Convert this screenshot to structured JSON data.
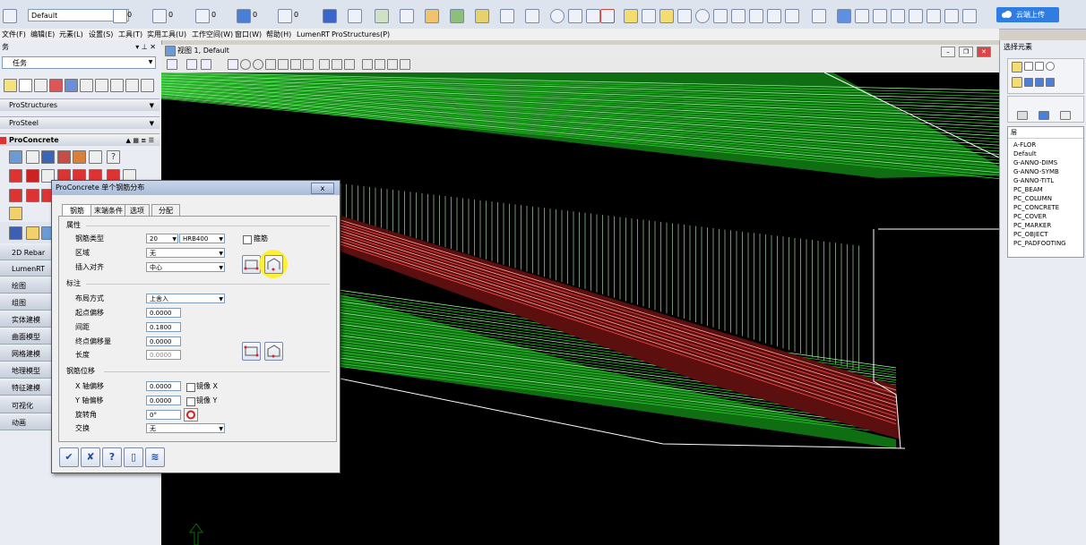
{
  "toolbar": {
    "level_combo": "Default",
    "color_value": "0",
    "style_value": "0",
    "weight_value": "0",
    "transparency_value": "0",
    "priority_value": "0",
    "cloud_upload_label": "云端上传"
  },
  "menu": [
    "文件(F)",
    "编辑(E)",
    "元素(L)",
    "设置(S)",
    "工具(T)",
    "实用工具(U)",
    "工作空间(W)",
    "窗口(W)",
    "帮助(H)",
    "LumenRT",
    "ProStructures(P)"
  ],
  "left_panel": {
    "title": "务",
    "task_combo": "任务",
    "sections": [
      "ProStructures",
      "ProSteel",
      "ProConcrete"
    ],
    "items": [
      "2D Rebar",
      "LumenRT",
      "绘图",
      "组图",
      "实体建模",
      "曲面模型",
      "网格建模",
      "地理模型",
      "特征建模",
      "可视化",
      "动画"
    ]
  },
  "viewport": {
    "title": "视图 1, Default"
  },
  "right_panel": {
    "title": "选择元素",
    "layer_header": "层",
    "layers": [
      "A-FLOR",
      "Default",
      "G-ANNO-DIMS",
      "G-ANNO-SYMB",
      "G-ANNO-TITL",
      "PC_BEAM",
      "PC_COLUMN",
      "PC_CONCRETE",
      "PC_COVER",
      "PC_MARKER",
      "PC_OBJECT",
      "PC_PADFOOTING"
    ]
  },
  "dialog": {
    "title": "ProConcrete 单个钢筋分布",
    "close": "x",
    "tabs": [
      "钢筋",
      "末端条件",
      "选项",
      "分配"
    ],
    "group_attributes": "属性",
    "rebar_type_label": "钢筋类型",
    "rebar_size": "20",
    "rebar_grade": "HRB400",
    "stirrup_label": "箍筋",
    "zone_label": "区域",
    "zone_value": "无",
    "align_label": "插入对齐",
    "align_value": "中心",
    "group_annotation": "标注",
    "layout_label": "布局方式",
    "layout_value": "上舍入",
    "start_offset_label": "起点偏移",
    "start_offset_value": "0.0000",
    "spacing_label": "间距",
    "spacing_value": "0.1800",
    "end_offset_label": "终点偏移量",
    "end_offset_value": "0.0000",
    "length_label": "长度",
    "length_value": "0.0000",
    "group_shift": "钢筋位移",
    "x_shift_label": "X 轴偏移",
    "x_shift_value": "0.0000",
    "mirror_x_label": "镜像 X",
    "y_shift_label": "Y 轴偏移",
    "y_shift_value": "0.0000",
    "mirror_y_label": "镜像 Y",
    "rotation_label": "旋转角",
    "rotation_value": "0°",
    "swap_label": "交换",
    "swap_value": "无"
  }
}
